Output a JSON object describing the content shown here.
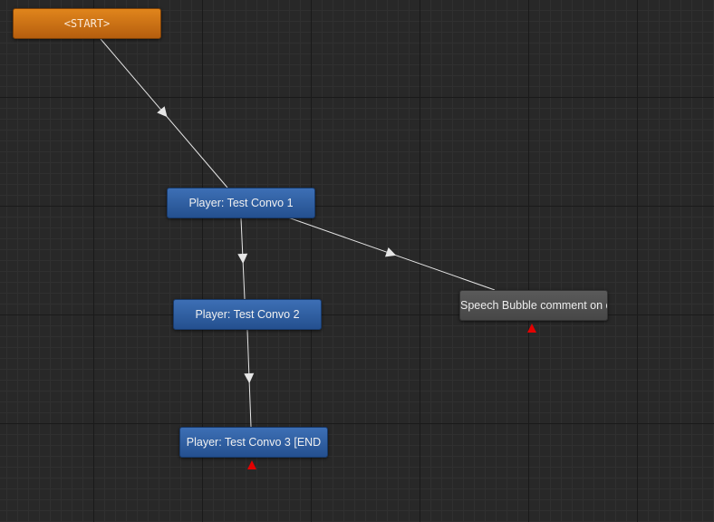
{
  "colors": {
    "background": "#282828",
    "start_node": "#d07318",
    "dialogue_node": "#2f5f9f",
    "comment_node": "#4f4f4f",
    "link_line": "#e6e6e6",
    "end_marker": "#e40000"
  },
  "nodes": {
    "start": {
      "label": "<START>"
    },
    "convo1": {
      "label": "Player: Test Convo 1"
    },
    "convo2": {
      "label": "Player: Test Convo 2"
    },
    "convo3": {
      "label": "Player: Test Convo  3 [END"
    },
    "bubble": {
      "label": "Speech Bubble comment on o"
    }
  },
  "links": [
    {
      "from": "<START>",
      "to": "Player: Test Convo 1"
    },
    {
      "from": "Player: Test Convo 1",
      "to": "Player: Test Convo 2"
    },
    {
      "from": "Player: Test Convo 1",
      "to": "Speech Bubble comment on o"
    },
    {
      "from": "Player: Test Convo 2",
      "to": "Player: Test Convo  3 [END"
    }
  ],
  "end_marker_icon": "red-triangle"
}
